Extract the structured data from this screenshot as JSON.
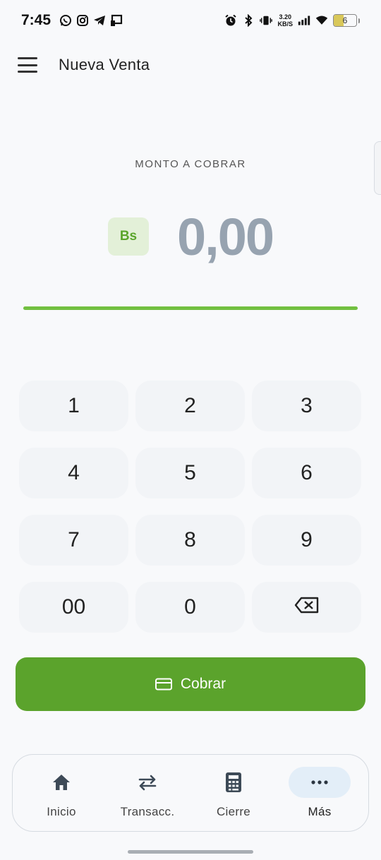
{
  "status_bar": {
    "time": "7:45",
    "net_speed_value": "3.20",
    "net_speed_unit": "KB/S",
    "battery_level": "6",
    "left_icons": [
      "whatsapp-icon",
      "instagram-icon",
      "telegram-icon",
      "cast-icon"
    ],
    "right_icons": [
      "alarm-icon",
      "bluetooth-icon",
      "vibrate-icon",
      "signal-icon",
      "wifi-icon",
      "battery-icon"
    ]
  },
  "app_bar": {
    "title": "Nueva Venta",
    "menu_icon": "hamburger-menu-icon"
  },
  "amount": {
    "label": "MONTO A COBRAR",
    "currency": "Bs",
    "value": "0,00",
    "accent_color": "#72c040"
  },
  "keypad": {
    "keys": [
      "1",
      "2",
      "3",
      "4",
      "5",
      "6",
      "7",
      "8",
      "9",
      "00",
      "0"
    ],
    "backspace_icon": "backspace-icon"
  },
  "charge_button": {
    "label": "Cobrar",
    "icon": "credit-card-icon",
    "color": "#5ba32c"
  },
  "bottom_nav": {
    "items": [
      {
        "label": "Inicio",
        "icon": "home-icon",
        "active": false
      },
      {
        "label": "Transacc.",
        "icon": "swap-arrows-icon",
        "active": false
      },
      {
        "label": "Cierre",
        "icon": "calculator-icon",
        "active": false
      },
      {
        "label": "Más",
        "icon": "more-dots-icon",
        "active": true
      }
    ]
  }
}
